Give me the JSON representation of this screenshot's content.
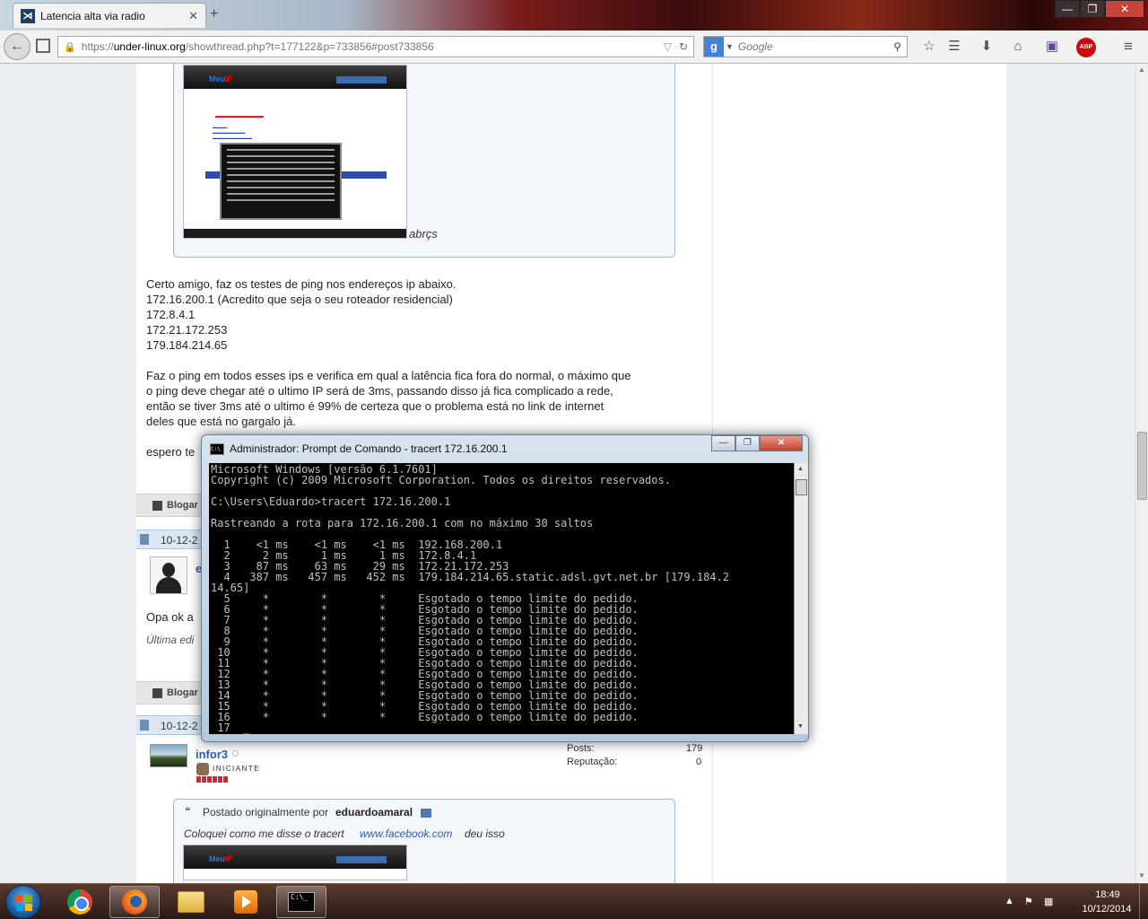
{
  "browser": {
    "tab_title": "Latencia alta via radio",
    "tab_close": "✕",
    "new_tab": "+",
    "url_scheme": "https://",
    "url_host": "under-linux.org",
    "url_path": "/showthread.php?t=177122&p=733856#post733856",
    "search_placeholder": "Google",
    "search_engine_icon": "g-icon",
    "abp_label": "ABP"
  },
  "page": {
    "quote1": {
      "image_trailing_text": "abrçs"
    },
    "reply_lines": [
      "Certo amigo, faz os testes de ping nos endereços ip abaixo.",
      "172.16.200.1 (Acredito que seja o seu roteador residencial)",
      "172.8.4.1",
      "172.21.172.253",
      "179.184.214.65"
    ],
    "paragraph2": [
      "Faz o ping em todos esses ips e verifica em qual a latência fica fora do normal, o máximo que",
      "o ping deve chegar até o ultimo IP será de 3ms, passando disso já fica complicado a rede,",
      "então se tiver 3ms até o ultimo é 99% de certeza que o problema está no link de internet",
      "deles que está no gargalo já."
    ],
    "signoff_partial": "espero te",
    "blog_label_1": "Blogar",
    "date_partial_1": "10-12-2",
    "user_partial": "e",
    "post2_partial": "Opa ok a",
    "edit_partial": "Última edi",
    "blog_label_2": "Blogar",
    "date_partial_2": "10-12-2",
    "user3": {
      "name": "infor3",
      "rank": "INICIANTE",
      "posts_label": "Posts:",
      "posts_value": "179",
      "rep_label": "Reputação:",
      "rep_value": "0"
    },
    "quote2": {
      "posted_by_prefix": "Postado originalmente por",
      "author": "eduardoamaral",
      "text_before_link": "Coloquei como me disse o tracert",
      "link": "www.facebook.com",
      "text_after_link": "deu isso"
    }
  },
  "cmd_window": {
    "title": "Administrador: Prompt de Comando - tracert  172.16.200.1",
    "icon_text": "C:\\",
    "lines": [
      "Microsoft Windows [versão 6.1.7601]",
      "Copyright (c) 2009 Microsoft Corporation. Todos os direitos reservados.",
      "",
      "C:\\Users\\Eduardo>tracert 172.16.200.1",
      "",
      "Rastreando a rota para 172.16.200.1 com no máximo 30 saltos",
      "",
      "  1    <1 ms    <1 ms    <1 ms  192.168.200.1",
      "  2     2 ms     1 ms     1 ms  172.8.4.1",
      "  3    87 ms    63 ms    29 ms  172.21.172.253",
      "  4   387 ms   457 ms   452 ms  179.184.214.65.static.adsl.gvt.net.br [179.184.2",
      "14.65]",
      "  5     *        *        *     Esgotado o tempo limite do pedido.",
      "  6     *        *        *     Esgotado o tempo limite do pedido.",
      "  7     *        *        *     Esgotado o tempo limite do pedido.",
      "  8     *        *        *     Esgotado o tempo limite do pedido.",
      "  9     *        *        *     Esgotado o tempo limite do pedido.",
      " 10     *        *        *     Esgotado o tempo limite do pedido.",
      " 11     *        *        *     Esgotado o tempo limite do pedido.",
      " 12     *        *        *     Esgotado o tempo limite do pedido.",
      " 13     *        *        *     Esgotado o tempo limite do pedido.",
      " 14     *        *        *     Esgotado o tempo limite do pedido.",
      " 15     *        *        *     Esgotado o tempo limite do pedido.",
      " 16     *        *        *     Esgotado o tempo limite do pedido.",
      " 17  _"
    ]
  },
  "taskbar": {
    "clock_time": "18:49",
    "clock_date": "10/12/2014",
    "pinned": [
      "chrome-icon",
      "firefox-icon",
      "explorer-folder-icon",
      "media-player-icon",
      "cmd-icon"
    ],
    "active": "cmd-icon"
  },
  "colors": {
    "link": "#2a5db0",
    "quote_border": "#9fb7d1",
    "date_bar": "#dbe7f5",
    "console_bg": "#000000",
    "console_fg": "#c0c0c0"
  }
}
